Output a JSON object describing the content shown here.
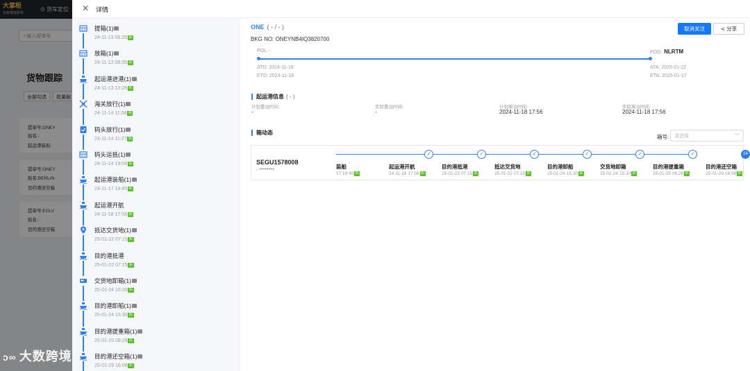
{
  "background": {
    "brand": "大掌柜",
    "brand_sub": "比较物流机构",
    "nav_item": "货车定位",
    "search_placeholder": "输入提单号",
    "page_title": "货物跟踪",
    "btn_select_all": "全部勾选",
    "btn_batch": "批量删",
    "cards": [
      {
        "line1": "提单号:ONEY",
        "line2": "船名:-",
        "line3": "起运港装船·"
      },
      {
        "line1": "提单号:ONEY",
        "line2": "船名:BERLIN",
        "line3": "目的港还空箱"
      },
      {
        "line1": "提单号:EGLV",
        "line2": "船名:-",
        "line3": "目的港还空箱"
      }
    ]
  },
  "drawer": {
    "title": "详情",
    "close_icon": "close-icon"
  },
  "timeline": [
    {
      "name": "提箱",
      "count": "(1)",
      "doc": true,
      "time": "24-11-13 06:26",
      "tag": "实",
      "icon": "container-icon"
    },
    {
      "name": "放箱",
      "count": "(1)",
      "doc": true,
      "time": "24-11-13 08:35",
      "tag": "实",
      "icon": "container-icon"
    },
    {
      "name": "起运港进港",
      "count": "(1)",
      "doc": true,
      "time": "24-11-13 13:28",
      "tag": "实",
      "icon": "ship-icon"
    },
    {
      "name": "海关放行",
      "count": "(1)",
      "doc": true,
      "time": "24-11-14 11:04",
      "tag": "实",
      "icon": "customs-icon"
    },
    {
      "name": "码头放行",
      "count": "(1)",
      "doc": true,
      "time": "24-11-14 11:27",
      "tag": "实",
      "icon": "checklist-icon"
    },
    {
      "name": "码头运抵",
      "count": "(1)",
      "doc": true,
      "time": "24-11-14 19:04",
      "tag": "实",
      "icon": "container-icon"
    },
    {
      "name": "起运港装船",
      "count": "(1)",
      "doc": true,
      "time": "24-11-17 19:45",
      "tag": "实",
      "icon": "ship-icon"
    },
    {
      "name": "起运港开航",
      "count": "",
      "doc": false,
      "time": "24-11-18 17:56",
      "tag": "实",
      "icon": "ship-icon"
    },
    {
      "name": "抵达交货地",
      "count": "(1)",
      "doc": true,
      "time": "25-01-22 07:15",
      "tag": "实",
      "icon": "location-icon"
    },
    {
      "name": "目的港抵港",
      "count": "",
      "doc": false,
      "time": "25-01-22 07:15",
      "tag": "实",
      "icon": "ship-icon"
    },
    {
      "name": "交货地卸箱",
      "count": "(1)",
      "doc": true,
      "time": "25-01-24 15:30",
      "tag": "实",
      "icon": "truck-icon"
    },
    {
      "name": "目的港卸船",
      "count": "(1)",
      "doc": true,
      "time": "25-01-24 15:30",
      "tag": "实",
      "icon": "ship-icon"
    },
    {
      "name": "目的港提重箱",
      "count": "(1)",
      "doc": true,
      "time": "25-01-25 08:26",
      "tag": "实",
      "icon": "ship-icon"
    },
    {
      "name": "目的港还空箱",
      "count": "(1)",
      "doc": true,
      "time": "25-01-29 16:08",
      "tag": "实",
      "icon": "ship-icon"
    }
  ],
  "detail": {
    "carrier": "ONE",
    "carrier_sub": "( - / - )",
    "bkg_label": "BKG NO:",
    "bkg_value": "ONEYNB4IQ3820700",
    "btn_unfollow": "取消关注",
    "btn_share": "分享",
    "pol_label": "POL:",
    "pol_value": "-",
    "pod_label": "POD:",
    "pod_value": "NLRTM",
    "atd": "ATD: 2024-11-18",
    "etd": "ETD: 2024-11-18",
    "ata": "ATA: 2025-01-22",
    "eta": "ETA: 2025-01-17",
    "departure_section": "起运港信息",
    "departure_sub": "( - )",
    "planned_berth_label": "计划靠泊时间:",
    "planned_berth_value": "-",
    "actual_berth_label": "实际靠泊时间:",
    "actual_berth_value": "-",
    "planned_depart_label": "计划离泊时间:",
    "planned_depart_value": "2024-11-18 17:56",
    "actual_depart_label": "实际离泊时间:",
    "actual_depart_value": "2024-11-18 17:56",
    "box_section": "箱动态",
    "box_no_label": "箱号:",
    "box_no_placeholder": "请选择",
    "container_no": "SEGU1578008",
    "container_sub": "- ********",
    "steps": [
      {
        "name": "装船",
        "time": "17 19:45",
        "tag": "实",
        "node": "",
        "current": false
      },
      {
        "name": "起运港开航",
        "time": "24-11-18 17:56",
        "tag": "实",
        "node": "✓",
        "current": false
      },
      {
        "name": "目的港抵港",
        "time": "25-01-22 07:15",
        "tag": "实",
        "node": "✓",
        "current": false
      },
      {
        "name": "抵达交货地",
        "time": "25-01-22 07:15",
        "tag": "实",
        "node": "✓",
        "current": false
      },
      {
        "name": "目的港卸船",
        "time": "25-01-24 15:30",
        "tag": "实",
        "node": "✓",
        "current": false
      },
      {
        "name": "交货地卸箱",
        "time": "25-01-24 15:30",
        "tag": "实",
        "node": "✓",
        "current": false
      },
      {
        "name": "目的港提重箱",
        "time": "25-01-25 08:26",
        "tag": "实",
        "node": "✓",
        "current": false
      },
      {
        "name": "目的港还空箱",
        "time": "25-01-29 16:08",
        "tag": "实",
        "node": "14",
        "current": true
      }
    ]
  },
  "watermark": "大数跨境",
  "colors": {
    "accent": "#2f80ed",
    "tag_green": "#52c41a",
    "button_blue": "#1677ff"
  }
}
